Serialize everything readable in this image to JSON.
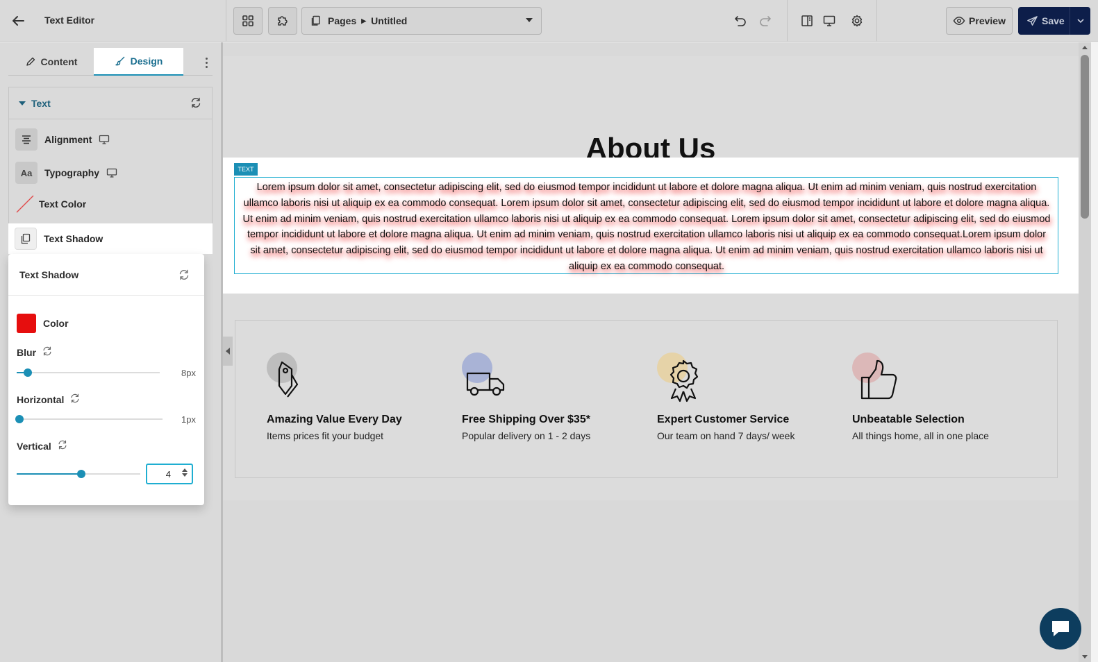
{
  "header": {
    "title": "Text Editor",
    "pages_label": "Pages",
    "page_name": "Untitled",
    "preview_label": "Preview",
    "save_label": "Save"
  },
  "sidebar": {
    "tabs": [
      {
        "label": "Content",
        "active": false
      },
      {
        "label": "Design",
        "active": true
      }
    ],
    "section_title": "Text",
    "props": [
      {
        "label": "Alignment",
        "icon": "align-center-icon"
      },
      {
        "label": "Typography",
        "icon": "typography-icon"
      },
      {
        "label": "Text Color",
        "icon": "no-color-icon"
      },
      {
        "label": "Text Shadow",
        "icon": "copy-icon"
      }
    ],
    "typography_glyph": "Aa",
    "popover": {
      "title": "Text Shadow",
      "color_label": "Color",
      "color_value": "#e60e0e",
      "blur_label": "Blur",
      "blur_value": "8px",
      "blur_level": 0.08,
      "horizontal_label": "Horizontal",
      "horizontal_value": "1px",
      "horizontal_level": 0.02,
      "vertical_label": "Vertical",
      "vertical_value": "4",
      "vertical_level": 0.52
    }
  },
  "canvas": {
    "heading": "About Us",
    "text_tag": "TEXT",
    "paragraph": "Lorem ipsum dolor sit amet, consectetur adipiscing elit, sed do eiusmod tempor incididunt ut labore et dolore magna aliqua. Ut enim ad minim veniam, quis nostrud exercitation ullamco laboris nisi ut aliquip ex ea commodo consequat. Lorem ipsum dolor sit amet, consectetur adipiscing elit, sed do eiusmod tempor incididunt ut labore et dolore magna aliqua. Ut enim ad minim veniam, quis nostrud exercitation ullamco laboris nisi ut aliquip ex ea commodo consequat. Lorem ipsum dolor sit amet, consectetur adipiscing elit, sed do eiusmod tempor incididunt ut labore et dolore magna aliqua. Ut enim ad minim veniam, quis nostrud exercitation ullamco laboris nisi ut aliquip ex ea commodo consequat.Lorem ipsum dolor sit amet, consectetur adipiscing elit, sed do eiusmod tempor incididunt ut labore et dolore magna aliqua. Ut enim ad minim veniam, quis nostrud exercitation ullamco laboris nisi ut aliquip ex ea commodo consequat.",
    "features": [
      {
        "title": "Amazing Value Every Day",
        "subtitle": "Items prices fit your budget",
        "icon": "price-tag-icon",
        "accent": "#bdbdbd"
      },
      {
        "title": "Free Shipping Over $35*",
        "subtitle": "Popular delivery on 1 - 2 days",
        "icon": "delivery-truck-icon",
        "accent": "#a9b3d6"
      },
      {
        "title": "Expert Customer Service",
        "subtitle": "Our team on hand 7 days/ week",
        "icon": "award-ribbon-icon",
        "accent": "#e6d3a8"
      },
      {
        "title": "Unbeatable Selection",
        "subtitle": "All things home, all in one place",
        "icon": "thumbs-up-icon",
        "accent": "#dcb8b8"
      }
    ]
  },
  "colors": {
    "accent": "#1b8fb5",
    "save_bg": "#0d1e4a",
    "shadow_color": "#e60e0e"
  }
}
